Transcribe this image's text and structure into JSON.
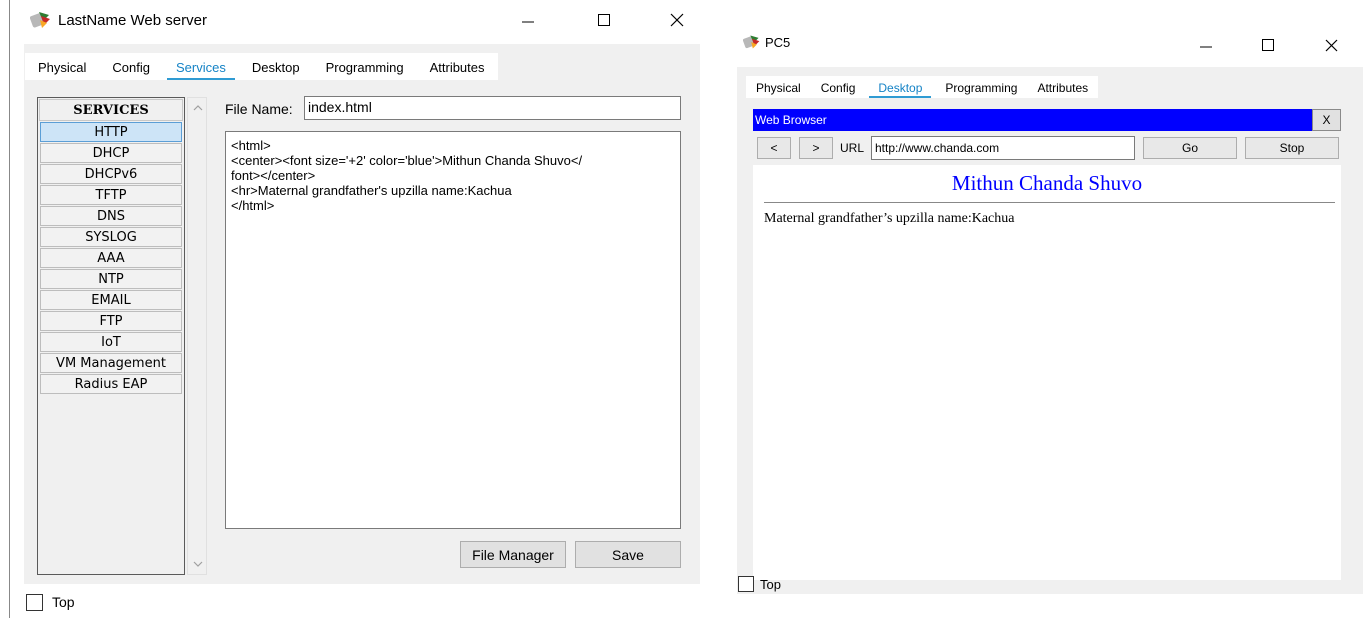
{
  "server_window": {
    "title": "LastName Web server",
    "tabs": [
      "Physical",
      "Config",
      "Services",
      "Desktop",
      "Programming",
      "Attributes"
    ],
    "active_tab": "Services",
    "services_header": "SERVICES",
    "services": [
      "HTTP",
      "DHCP",
      "DHCPv6",
      "TFTP",
      "DNS",
      "SYSLOG",
      "AAA",
      "NTP",
      "EMAIL",
      "FTP",
      "IoT",
      "VM Management",
      "Radius EAP"
    ],
    "selected_service": "HTTP",
    "file_name_label": "File Name:",
    "file_name_value": "index.html",
    "file_content": "<html>\n<center><font size='+2' color='blue'>Mithun Chanda Shuvo</\nfont></center>\n<hr>Maternal grandfather's upzilla name:Kachua\n</html>",
    "file_manager_label": "File Manager",
    "save_label": "Save",
    "top_label": "Top"
  },
  "pc_window": {
    "title": "PC5",
    "tabs": [
      "Physical",
      "Config",
      "Desktop",
      "Programming",
      "Attributes"
    ],
    "active_tab": "Desktop",
    "browser_title": "Web Browser",
    "close_label": "X",
    "back_label": "<",
    "forward_label": ">",
    "url_label": "URL",
    "url_value": "http://www.chanda.com",
    "go_label": "Go",
    "stop_label": "Stop",
    "page_heading": "Mithun Chanda Shuvo",
    "page_text": "Maternal grandfather’s upzilla name:Kachua",
    "top_label": "Top"
  },
  "colors": {
    "tab_active": "#1583c6",
    "browser_bar": "#0000ff",
    "page_heading": "#0000ff",
    "panel_bg": "#f0f0f0"
  }
}
